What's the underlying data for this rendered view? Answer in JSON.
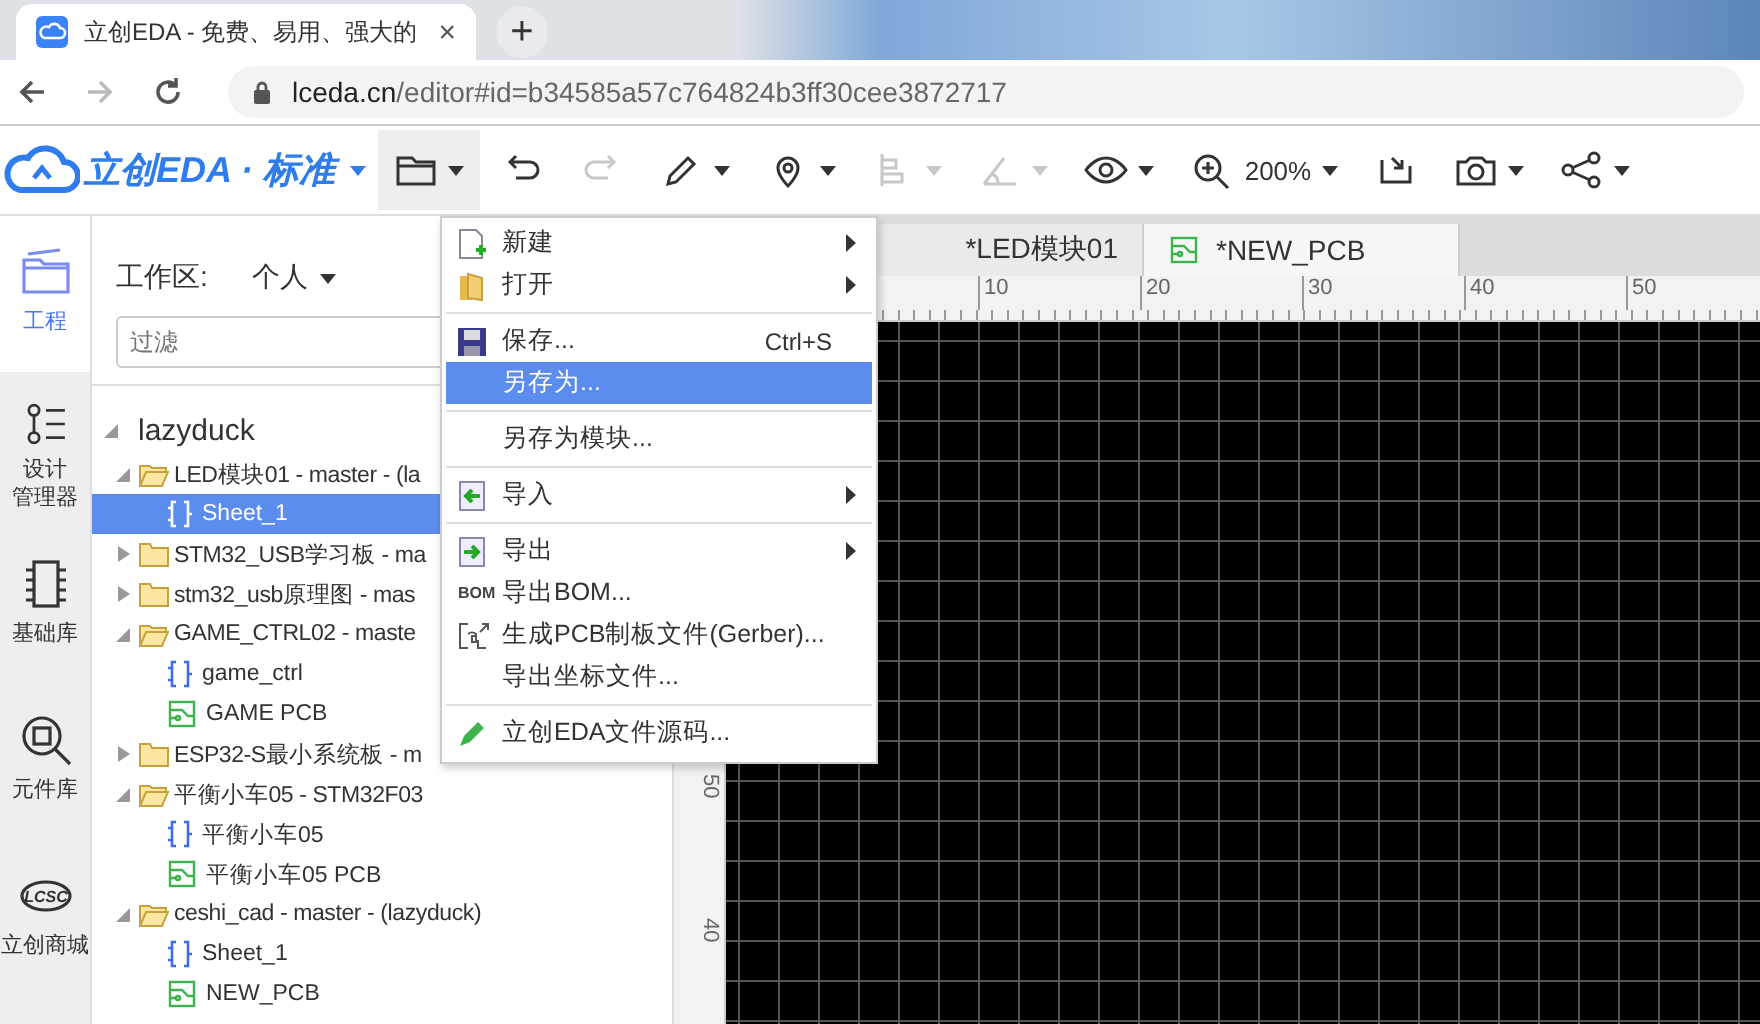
{
  "browser": {
    "tab_title": "立创EDA - 免费、易用、强大的",
    "close": "×",
    "new_tab": "+",
    "url_host": "lceda.cn",
    "url_path": "/editor#id=b34585a57c764824b3ff30cee3872717"
  },
  "toolbar": {
    "logo": "立创EDA · 标准",
    "zoom": "200%",
    "tools": [
      {
        "kind": "folder",
        "disabled": false,
        "selected": true
      },
      {
        "kind": "undo",
        "disabled": false,
        "selected": false
      },
      {
        "kind": "redo",
        "disabled": true,
        "selected": false
      },
      {
        "kind": "pencil",
        "disabled": false,
        "selected": false
      },
      {
        "kind": "pin",
        "disabled": false,
        "selected": false
      },
      {
        "kind": "align",
        "disabled": true,
        "selected": false
      },
      {
        "kind": "measure",
        "disabled": true,
        "selected": false
      },
      {
        "kind": "eye",
        "disabled": false,
        "selected": false
      },
      {
        "kind": "zoom",
        "disabled": false,
        "selected": false
      },
      {
        "kind": "import",
        "disabled": false,
        "selected": false
      },
      {
        "kind": "camera",
        "disabled": false,
        "selected": false
      },
      {
        "kind": "share",
        "disabled": false,
        "selected": false
      }
    ]
  },
  "rail": [
    {
      "kind": "project",
      "lines": [
        "工程"
      ],
      "selected": true
    },
    {
      "kind": "design",
      "lines": [
        "设计",
        "管理器"
      ],
      "selected": false
    },
    {
      "kind": "chip",
      "lines": [
        "基础库"
      ],
      "selected": false
    },
    {
      "kind": "search",
      "lines": [
        "元件库"
      ],
      "selected": false
    },
    {
      "kind": "shop",
      "lines": [
        "立创商城"
      ],
      "logo": "LCSC",
      "selected": false
    }
  ],
  "project_panel": {
    "workspace_label": "工作区:",
    "workspace": "个人",
    "filter_placeholder": "过滤",
    "owner": "lazyduck",
    "tree": [
      {
        "label": "LED模块01 - master - (la",
        "expanded": true,
        "selected": false,
        "children": [
          {
            "kind": "schematic",
            "label": "Sheet_1",
            "selected": true
          }
        ]
      },
      {
        "label": "STM32_USB学习板 - ma",
        "expanded": false,
        "selected": false
      },
      {
        "label": "stm32_usb原理图 - mas",
        "expanded": false,
        "selected": false
      },
      {
        "label": "GAME_CTRL02 - maste",
        "expanded": true,
        "selected": false,
        "children": [
          {
            "kind": "schematic",
            "label": "game_ctrl",
            "selected": false
          },
          {
            "kind": "pcb",
            "label": "GAME PCB",
            "selected": false
          }
        ]
      },
      {
        "label": "ESP32-S最小系统板 - m",
        "expanded": false,
        "selected": false
      },
      {
        "label": "平衡小车05 - STM32F03",
        "expanded": true,
        "selected": false,
        "children": [
          {
            "kind": "schematic",
            "label": "平衡小车05",
            "selected": false
          },
          {
            "kind": "pcb",
            "label": "平衡小车05 PCB",
            "selected": false
          }
        ]
      },
      {
        "label": "ceshi_cad - master - (lazyduck)",
        "expanded": true,
        "selected": false,
        "children": [
          {
            "kind": "schematic",
            "label": "Sheet_1",
            "selected": false
          },
          {
            "kind": "pcb",
            "label": "NEW_PCB",
            "selected": false
          }
        ]
      }
    ]
  },
  "editor_tabs": [
    {
      "kind": "schematic",
      "label": "*LED模块01",
      "selected": false
    },
    {
      "kind": "pcb",
      "label": "*NEW_PCB",
      "selected": true
    }
  ],
  "ruler": {
    "x_labels": [
      "10",
      "20",
      "30",
      "40",
      "50"
    ],
    "y_labels": [
      "50",
      "40"
    ]
  },
  "menu": [
    {
      "kind": "item",
      "label": "新建",
      "submenu": true,
      "selected": false
    },
    {
      "kind": "item",
      "label": "打开",
      "submenu": true,
      "selected": false
    },
    {
      "kind": "separator"
    },
    {
      "kind": "item",
      "label": "保存...",
      "shortcut": "Ctrl+S",
      "submenu": false,
      "selected": false
    },
    {
      "kind": "item",
      "label": "另存为...",
      "submenu": false,
      "selected": true
    },
    {
      "kind": "separator"
    },
    {
      "kind": "item",
      "label": "另存为模块...",
      "submenu": false,
      "selected": false
    },
    {
      "kind": "separator"
    },
    {
      "kind": "item",
      "label": "导入",
      "submenu": true,
      "selected": false
    },
    {
      "kind": "separator"
    },
    {
      "kind": "item",
      "label": "导出",
      "submenu": true,
      "selected": false
    },
    {
      "kind": "item",
      "icon_text": "BOM",
      "label": "导出BOM...",
      "submenu": false,
      "selected": false
    },
    {
      "kind": "item",
      "label": "生成PCB制板文件(Gerber)...",
      "submenu": false,
      "selected": false
    },
    {
      "kind": "item",
      "label": "导出坐标文件...",
      "submenu": false,
      "selected": false
    },
    {
      "kind": "separator"
    },
    {
      "kind": "item",
      "label": "立创EDA文件源码...",
      "submenu": false,
      "selected": false
    }
  ]
}
